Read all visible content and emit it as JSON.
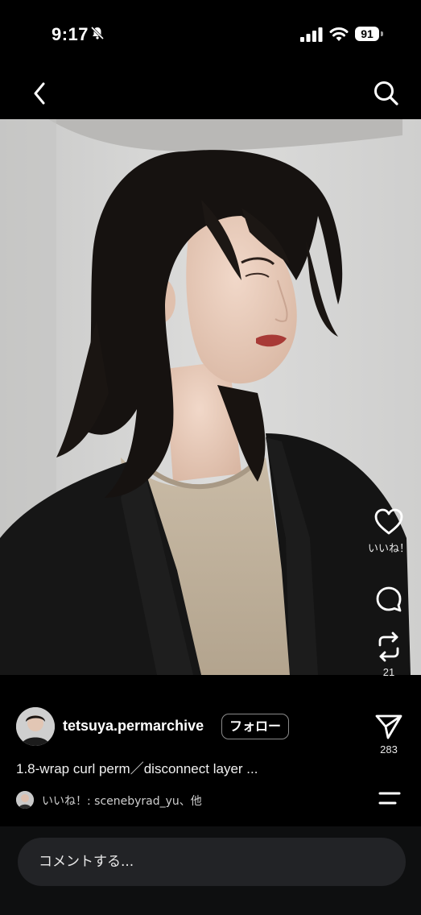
{
  "status_bar": {
    "time": "9:17",
    "battery": "91",
    "icons": [
      "mute-icon",
      "signal-icon",
      "wifi-icon"
    ]
  },
  "nav": {
    "back_icon": "chevron-left-icon",
    "search_icon": "search-icon"
  },
  "post": {
    "image_subject": "photo",
    "actions": {
      "like_label": "いいね！",
      "repost_count": "21",
      "share_count": "283"
    },
    "author": {
      "username": "tetsuya.permarchive",
      "follow_label": "フォロー"
    },
    "caption": "1.8-wrap curl perm／disconnect layer ...",
    "liked_by": "いいね！: scenebyrad_yu、他"
  },
  "comment": {
    "placeholder": "コメントする..."
  },
  "colors": {
    "background": "#000000",
    "comment_bar": "#0e0f10",
    "input_bg": "#222326",
    "lip": "#a83a36"
  }
}
